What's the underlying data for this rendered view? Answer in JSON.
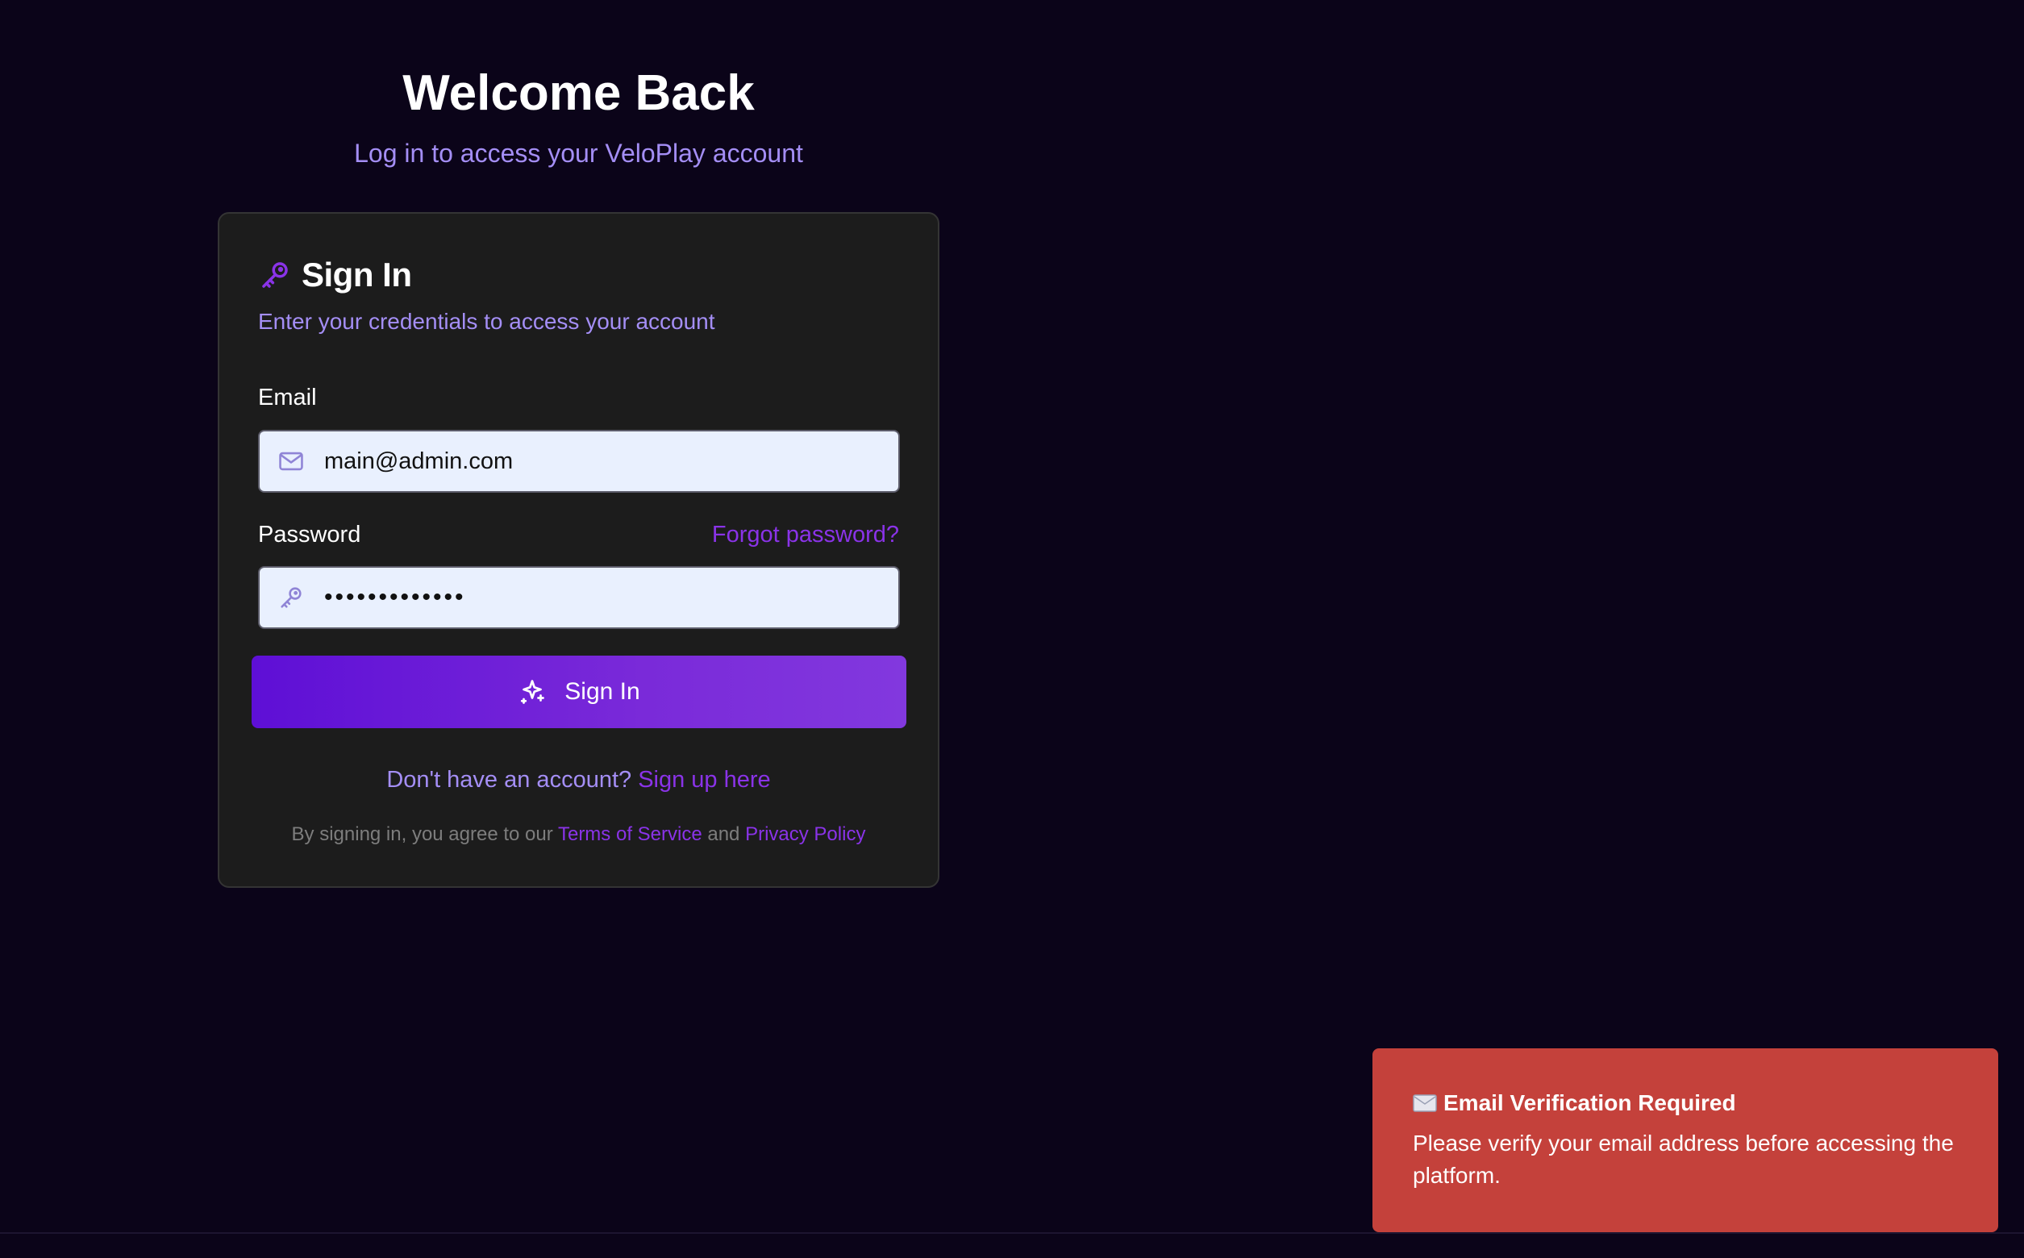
{
  "hero": {
    "title": "Welcome Back",
    "subtitle": "Log in to access your VeloPlay account"
  },
  "card": {
    "title": "Sign In",
    "title_icon": "key-icon",
    "description": "Enter your credentials to access your account",
    "email": {
      "label": "Email",
      "value": "main@admin.com",
      "icon": "mail-icon"
    },
    "password": {
      "label": "Password",
      "masked_value": "•••••••••••••",
      "forgot_label": "Forgot password?",
      "icon": "key-icon"
    },
    "submit_label": "Sign In",
    "submit_icon": "sparkles-icon",
    "signup_prompt": "Don't have an account?",
    "signup_link": "Sign up here",
    "legal_prefix": "By signing in, you agree to our",
    "terms_link": "Terms of Service",
    "legal_and": "and",
    "privacy_link": "Privacy Policy"
  },
  "toast": {
    "title": "Email Verification Required",
    "icon": "mail-emoji-icon",
    "message": "Please verify your email address before accessing the platform."
  },
  "colors": {
    "background": "#0b0419",
    "card": "#1c1c1c",
    "accent": "#8a33e8",
    "muted_purple": "#a48ef5",
    "toast": "#c4413b"
  }
}
